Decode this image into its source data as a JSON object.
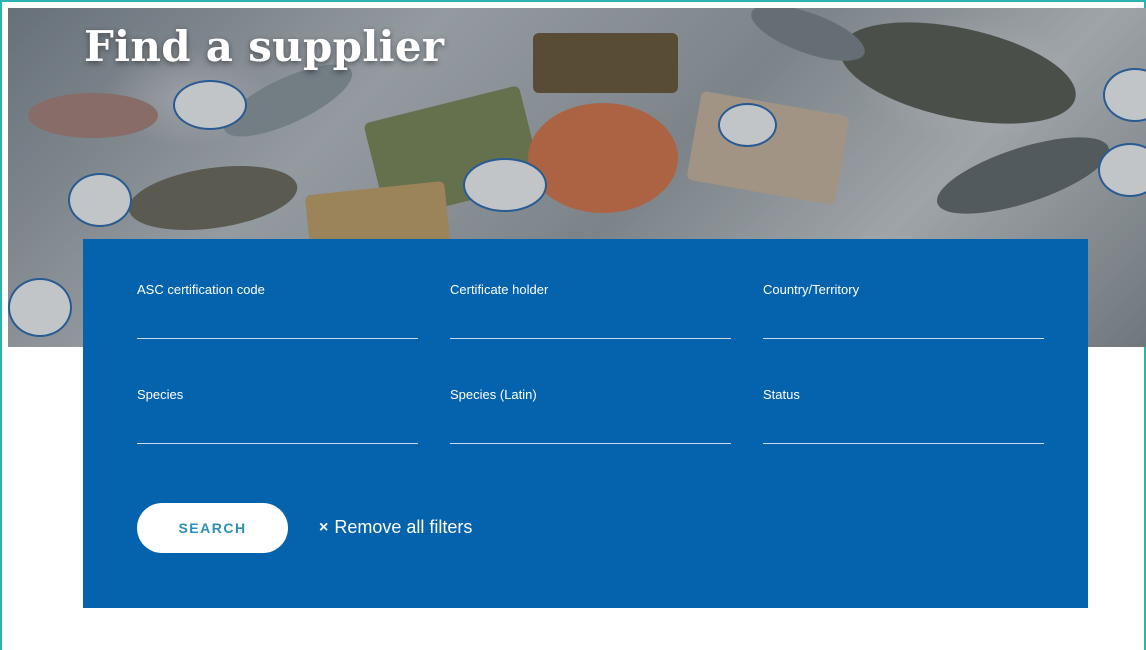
{
  "hero": {
    "title": "Find a supplier"
  },
  "filters": {
    "fields": [
      {
        "label": "ASC certification code",
        "value": ""
      },
      {
        "label": "Certificate holder",
        "value": ""
      },
      {
        "label": "Country/Territory",
        "value": ""
      },
      {
        "label": "Species",
        "value": ""
      },
      {
        "label": "Species (Latin)",
        "value": ""
      },
      {
        "label": "Status",
        "value": ""
      }
    ],
    "search_label": "SEARCH",
    "remove_label": "Remove all filters",
    "remove_icon": "close-icon"
  },
  "colors": {
    "panel": "#0563ad",
    "accent_border": "#2bb3b3",
    "button_text": "#2a8fb5"
  }
}
